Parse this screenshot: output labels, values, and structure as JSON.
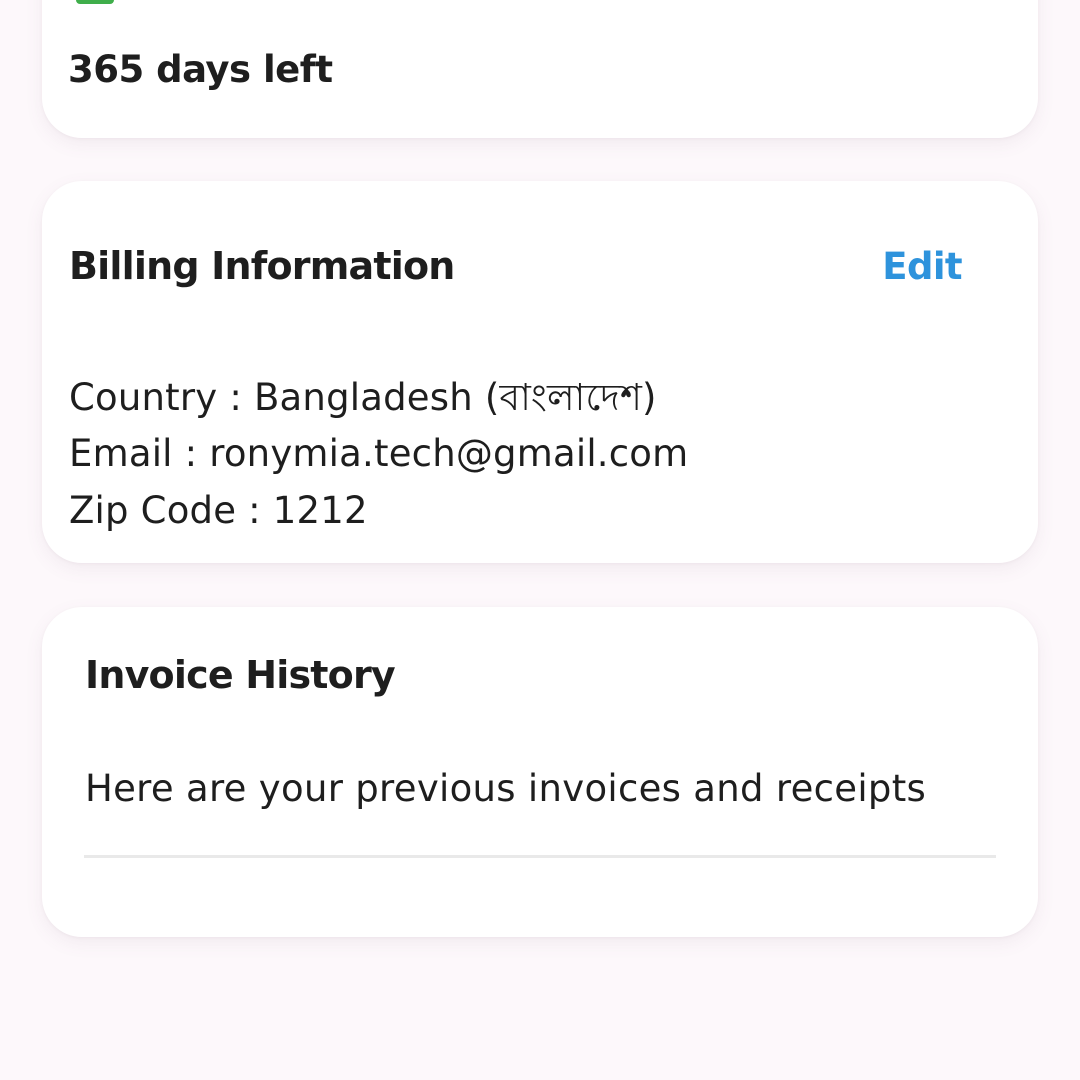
{
  "subscription": {
    "status_color": "#3fae4b",
    "days_left": "365 days left"
  },
  "billing": {
    "title": "Billing Information",
    "edit_label": "Edit",
    "accent_color": "#2e93dc",
    "country_line": "Country : Bangladesh (বাংলাদেশ)",
    "email_line": "Email : ronymia.tech@gmail.com",
    "zip_line": "Zip Code : 1212"
  },
  "invoice": {
    "title": "Invoice History",
    "description": "Here are your previous invoices and receipts"
  }
}
